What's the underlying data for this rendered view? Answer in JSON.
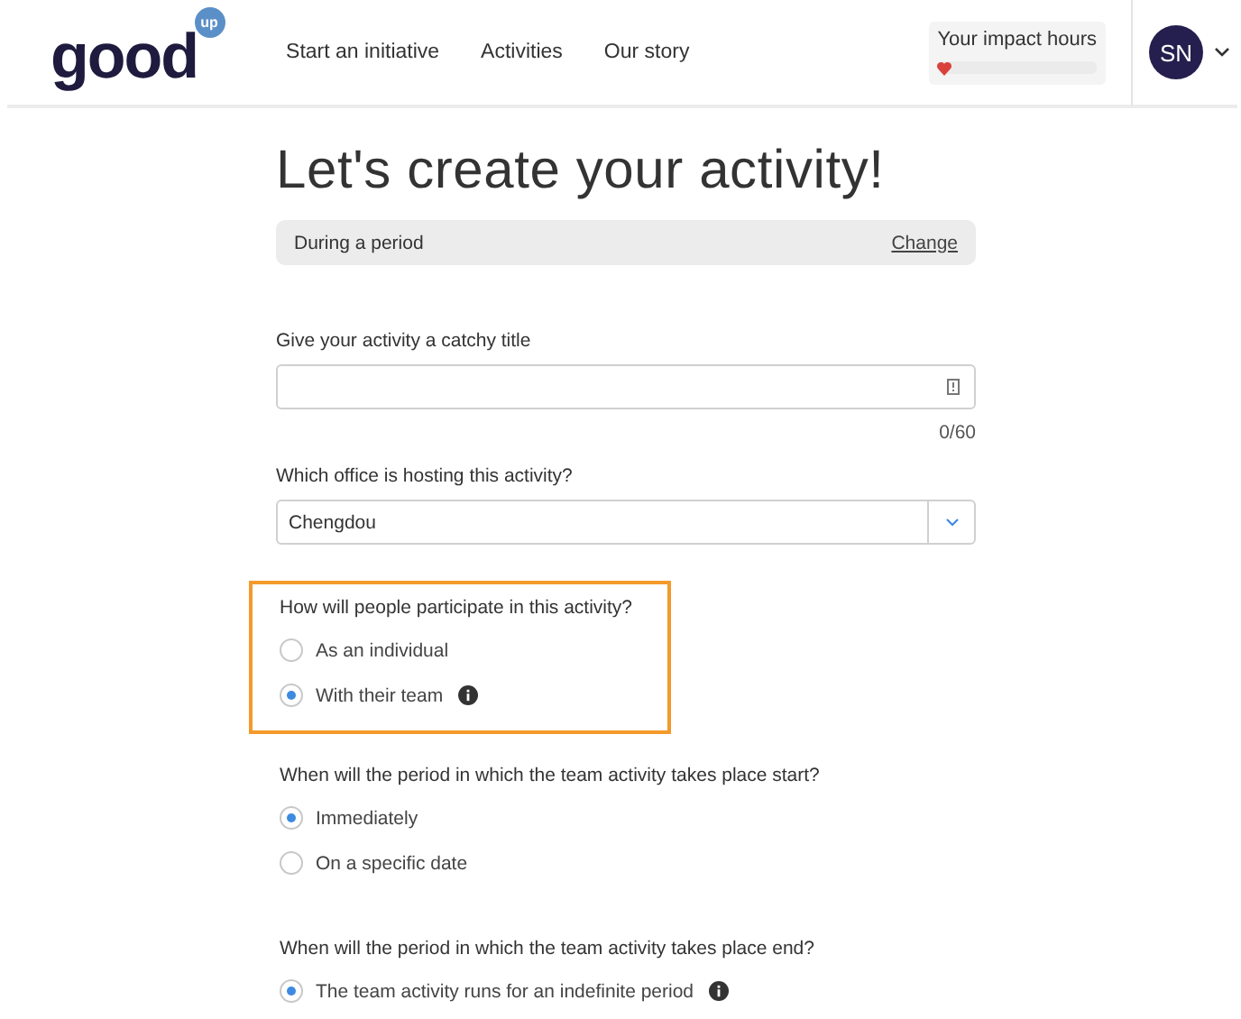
{
  "header": {
    "logo": "good",
    "logo_badge": "up",
    "nav": [
      {
        "label": "Start an initiative"
      },
      {
        "label": "Activities"
      },
      {
        "label": "Our story"
      }
    ],
    "impact": {
      "label": "Your impact hours",
      "level": 0
    },
    "avatar": "SN"
  },
  "page_title": "Let's create your activity!",
  "period": {
    "value": "During a period",
    "action": "Change"
  },
  "title_field": {
    "label": "Give your activity a catchy title",
    "counter": "0/60"
  },
  "office_field": {
    "label": "Which office is hosting this activity?",
    "value": "Chengdou"
  },
  "questions": [
    {
      "question": "How will people participate in this activity?",
      "highlighted": true,
      "options": [
        {
          "label": "As an individual",
          "selected": false,
          "info": false
        },
        {
          "label": "With their team",
          "selected": true,
          "info": true
        }
      ]
    },
    {
      "question": "When will the period in which the team activity takes place start?",
      "highlighted": false,
      "options": [
        {
          "label": "Immediately",
          "selected": true,
          "info": false
        },
        {
          "label": "On a specific date",
          "selected": false,
          "info": false
        }
      ]
    },
    {
      "question": "When will the period in which the team activity takes place end?",
      "highlighted": false,
      "options": [
        {
          "label": "The team activity runs for an indefinite period",
          "selected": true,
          "info": true
        }
      ]
    }
  ]
}
